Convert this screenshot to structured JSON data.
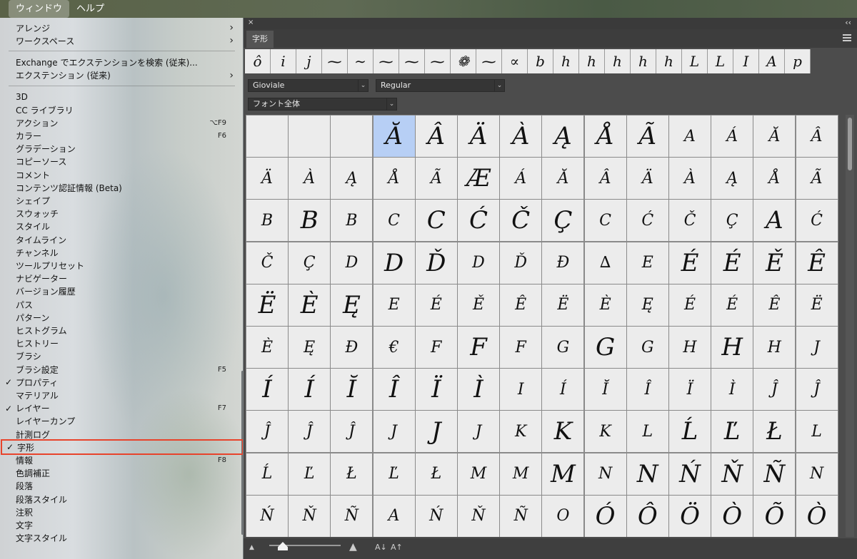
{
  "menubar": {
    "items": [
      "ウィンドウ",
      "ヘルプ"
    ]
  },
  "menu": {
    "items": [
      {
        "label": "アレンジ",
        "submenu": true
      },
      {
        "label": "ワークスペース",
        "submenu": true
      },
      {
        "sep": true
      },
      {
        "label": "Exchange でエクステンションを検索 (従来)..."
      },
      {
        "label": "エクステンション (従来)",
        "submenu": true
      },
      {
        "sep": true
      },
      {
        "label": "3D"
      },
      {
        "label": "CC ライブラリ"
      },
      {
        "label": "アクション",
        "shortcut": "⌥F9"
      },
      {
        "label": "カラー",
        "shortcut": "F6"
      },
      {
        "label": "グラデーション"
      },
      {
        "label": "コピーソース"
      },
      {
        "label": "コメント"
      },
      {
        "label": "コンテンツ認証情報 (Beta)"
      },
      {
        "label": "シェイプ"
      },
      {
        "label": "スウォッチ"
      },
      {
        "label": "スタイル"
      },
      {
        "label": "タイムライン"
      },
      {
        "label": "チャンネル"
      },
      {
        "label": "ツールプリセット"
      },
      {
        "label": "ナビゲーター"
      },
      {
        "label": "バージョン履歴"
      },
      {
        "label": "パス"
      },
      {
        "label": "パターン"
      },
      {
        "label": "ヒストグラム"
      },
      {
        "label": "ヒストリー"
      },
      {
        "label": "ブラシ"
      },
      {
        "label": "ブラシ設定",
        "shortcut": "F5"
      },
      {
        "label": "プロパティ",
        "checked": true
      },
      {
        "label": "マテリアル"
      },
      {
        "label": "レイヤー",
        "checked": true,
        "shortcut": "F7"
      },
      {
        "label": "レイヤーカンプ"
      },
      {
        "label": "計測ログ"
      },
      {
        "label": "字形",
        "checked": true,
        "highlight": true
      },
      {
        "label": "情報",
        "shortcut": "F8"
      },
      {
        "label": "色調補正"
      },
      {
        "label": "段落"
      },
      {
        "label": "段落スタイル"
      },
      {
        "label": "注釈"
      },
      {
        "label": "文字"
      },
      {
        "label": "文字スタイル"
      }
    ]
  },
  "panel": {
    "tab_label": "字形",
    "close_icon": "×",
    "collapse_icon": "‹‹",
    "font_family": "Gioviale",
    "font_style": "Regular",
    "subset": "フォント全体",
    "recent_glyphs": [
      "ô",
      "i",
      "j",
      "⁓",
      "∼",
      "⁓",
      "⁓",
      "⁓",
      "❁",
      "⁓",
      "∝",
      "b",
      "h",
      "h",
      "h",
      "h",
      "h",
      "L",
      "L",
      "I",
      "A",
      "p"
    ],
    "grid_rows": [
      [
        "",
        "",
        "",
        "Ă",
        "Â",
        "Ä",
        "À",
        "Ą",
        "Å",
        "Ã",
        "A",
        "Á",
        "Ă",
        "Â"
      ],
      [
        "Ä",
        "À",
        "Ą",
        "Å",
        "Ã",
        "Æ",
        "Á",
        "Ă",
        "Â",
        "Ä",
        "À",
        "Ą",
        "Å",
        "Ã"
      ],
      [
        "B",
        "B",
        "B",
        "C",
        "C",
        "Ć",
        "Č",
        "Ç",
        "C",
        "Ć",
        "Č",
        "Ç",
        "A",
        "Ć"
      ],
      [
        "Č",
        "Ç",
        "D",
        "D",
        "Ď",
        "D",
        "Ď",
        "Đ",
        "∆",
        "E",
        "É",
        "É",
        "Ě",
        "Ê"
      ],
      [
        "Ë",
        "È",
        "Ę",
        "E",
        "É",
        "Ě",
        "Ê",
        "Ë",
        "È",
        "Ę",
        "É",
        "É",
        "Ê",
        "Ë"
      ],
      [
        "È",
        "Ę",
        "Đ",
        "€",
        "F",
        "F",
        "F",
        "G",
        "G",
        "G",
        "H",
        "H",
        "H",
        "J"
      ],
      [
        "Í",
        "Í",
        "Ĭ",
        "Î",
        "Ï",
        "Ì",
        "I",
        "Í",
        "Ĭ",
        "Î",
        "Ï",
        "Ì",
        "Ĵ",
        "Ĵ"
      ],
      [
        "Ĵ",
        "Ĵ",
        "Ĵ",
        "J",
        "J",
        "J",
        "K",
        "K",
        "K",
        "L",
        "Ĺ",
        "Ľ",
        "Ł",
        "L"
      ],
      [
        "Ĺ",
        "Ľ",
        "Ł",
        "Ľ",
        "Ł",
        "M",
        "M",
        "M",
        "N",
        "N",
        "Ń",
        "Ň",
        "Ñ",
        "N"
      ],
      [
        "Ń",
        "Ň",
        "Ñ",
        "A",
        "Ń",
        "Ň",
        "Ñ",
        "O",
        "Ó",
        "Ô",
        "Ö",
        "Ò",
        "Õ",
        "Ò"
      ]
    ],
    "big_cells": [
      [
        0,
        3
      ],
      [
        0,
        4
      ],
      [
        0,
        5
      ],
      [
        0,
        6
      ],
      [
        0,
        7
      ],
      [
        0,
        8
      ],
      [
        0,
        9
      ],
      [
        1,
        5
      ],
      [
        2,
        1
      ],
      [
        2,
        4
      ],
      [
        2,
        5
      ],
      [
        2,
        6
      ],
      [
        2,
        7
      ],
      [
        2,
        12
      ],
      [
        3,
        3
      ],
      [
        3,
        4
      ],
      [
        3,
        10
      ],
      [
        3,
        11
      ],
      [
        3,
        12
      ],
      [
        3,
        13
      ],
      [
        4,
        0
      ],
      [
        4,
        1
      ],
      [
        4,
        2
      ],
      [
        5,
        5
      ],
      [
        5,
        8
      ],
      [
        5,
        11
      ],
      [
        6,
        0
      ],
      [
        6,
        1
      ],
      [
        6,
        2
      ],
      [
        6,
        3
      ],
      [
        6,
        4
      ],
      [
        6,
        5
      ],
      [
        7,
        4
      ],
      [
        7,
        7
      ],
      [
        7,
        10
      ],
      [
        7,
        11
      ],
      [
        7,
        12
      ],
      [
        8,
        7
      ],
      [
        8,
        9
      ],
      [
        8,
        10
      ],
      [
        8,
        11
      ],
      [
        8,
        12
      ],
      [
        9,
        8
      ],
      [
        9,
        9
      ],
      [
        9,
        10
      ],
      [
        9,
        11
      ],
      [
        9,
        12
      ],
      [
        9,
        13
      ]
    ],
    "selected_cell": [
      0,
      3
    ],
    "bottom_icons": [
      "A↓",
      "A↑"
    ]
  }
}
